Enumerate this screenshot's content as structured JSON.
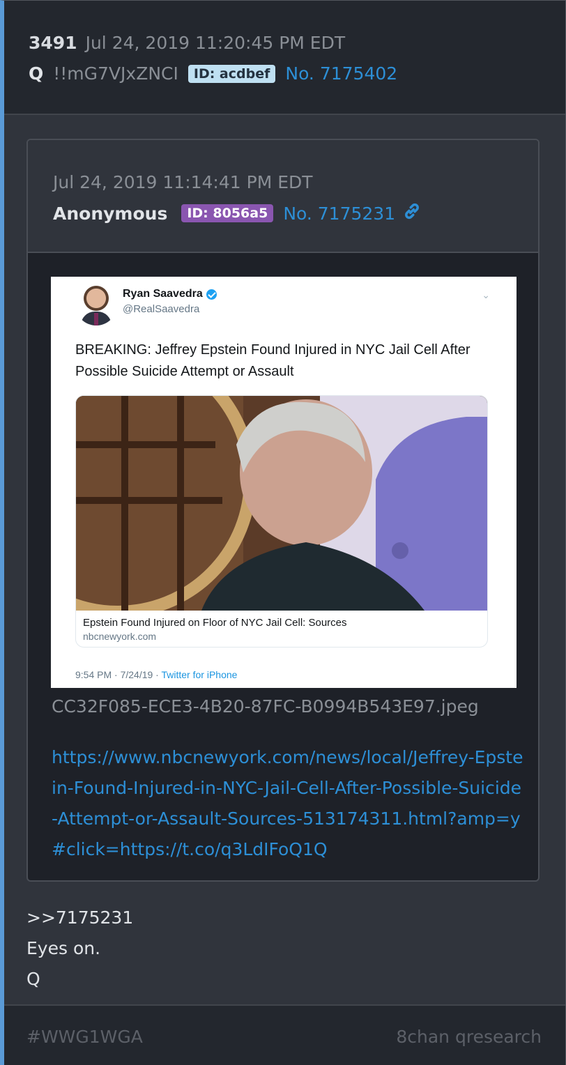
{
  "post": {
    "number": "3491",
    "datetime": "Jul 24, 2019 11:20:45 PM EDT",
    "author": "Q",
    "tripcode": "!!mG7VJxZNCI",
    "id_label": "ID: acdbef",
    "post_no": "No. 7175402",
    "body_lines": [
      ">>7175231",
      "Eyes on.",
      "Q"
    ]
  },
  "quoted": {
    "datetime": "Jul 24, 2019 11:14:41 PM EDT",
    "author": "Anonymous",
    "id_label": "ID: 8056a5",
    "post_no": "No. 7175231",
    "filename": "CC32F085-ECE3-4B20-87FC-B0994B543E97.jpeg",
    "url": "https://www.nbcnewyork.com/news/local/Jeffrey-Epstein-Found-Injured-in-NYC-Jail-Cell-After-Possible-Suicide-Attempt-or-Assault-Sources-513174311.html?amp=y#click=https://t.co/q3LdIFoQ1Q"
  },
  "tweet": {
    "name": "Ryan Saavedra",
    "handle": "@RealSaavedra",
    "text": "BREAKING: Jeffrey Epstein Found Injured in NYC Jail Cell After Possible Suicide Attempt or Assault",
    "card_title": "Epstein Found Injured on Floor of NYC Jail Cell: Sources",
    "card_domain": "nbcnewyork.com",
    "timestamp": "9:54 PM · 7/24/19 · ",
    "source": "Twitter for iPhone"
  },
  "footer": {
    "hashtag": "#WWG1WGA",
    "board": "8chan qresearch"
  },
  "colors": {
    "accent_border": "#5a9ad6",
    "link_blue": "#2d8fd6",
    "id_q_bg": "#bfe0f2",
    "id_anon_bg": "#8a56b0"
  },
  "icons": [
    "link-icon",
    "verified-icon",
    "chevron-down-icon"
  ]
}
